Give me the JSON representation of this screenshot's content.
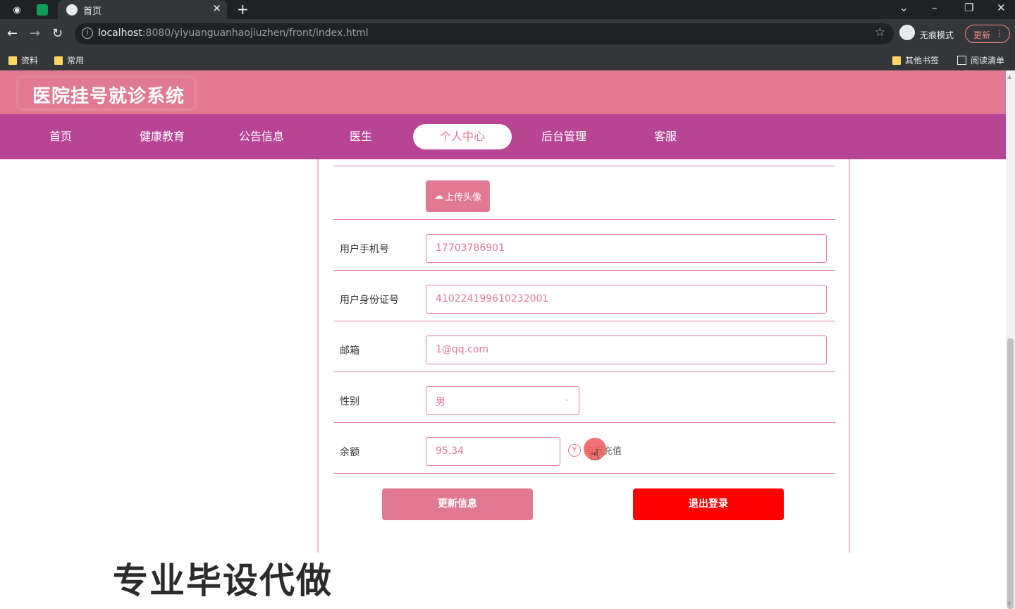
{
  "browser": {
    "tab_title": "首页",
    "url_host": "localhost",
    "url_rest": ":8080/yiyuanguanhaojiuzhen/front/index.html",
    "incognito_label": "无痕模式",
    "update_label": "更新",
    "bookmarks": [
      "资料",
      "常用"
    ],
    "bookmarks_right": [
      "其他书签",
      "阅读清单"
    ]
  },
  "site": {
    "title": "医院挂号就诊系统",
    "nav": [
      "首页",
      "健康教育",
      "公告信息",
      "医生",
      "个人中心",
      "后台管理",
      "客服"
    ],
    "active_nav": "个人中心"
  },
  "profile": {
    "upload_label": "上传头像",
    "fields": [
      {
        "label": "用户手机号",
        "value": "17703786901"
      },
      {
        "label": "用户身份证号",
        "value": "410224199610232001"
      },
      {
        "label": "邮箱",
        "value": "1@qq.com"
      },
      {
        "label": "性别",
        "value": "男"
      },
      {
        "label": "余额",
        "value": "95.34"
      }
    ],
    "recharge_label": "点我充值",
    "update_button": "更新信息",
    "logout_button": "退出登录"
  },
  "colors": {
    "primary": "#e27993",
    "nav_bg": "#b84594",
    "danger": "#ff0000"
  },
  "watermark": "专业毕设代做"
}
